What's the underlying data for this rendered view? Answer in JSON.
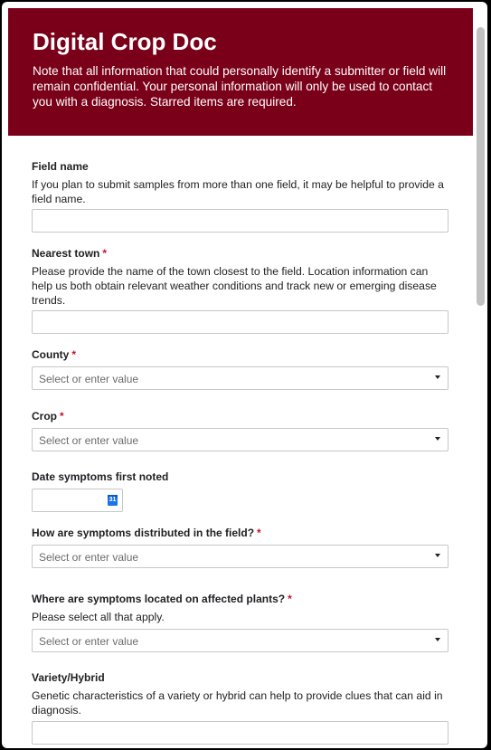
{
  "header": {
    "title": "Digital Crop Doc",
    "note": "Note that all information that could personally identify a submitter or field will remain confidential. Your personal information will only be used to contact you with a diagnosis. Starred items are required."
  },
  "colors": {
    "header_bg": "#7a0019",
    "required": "#c8102e",
    "calendar_icon": "#1a73e8"
  },
  "required_marker": "*",
  "fields": {
    "field_name": {
      "label": "Field name",
      "help": "If you plan to submit samples from more than one field, it may be helpful to provide a field name.",
      "value": ""
    },
    "nearest_town": {
      "label": "Nearest town",
      "help": "Please provide the name of the town closest to the field. Location information can help us both obtain relevant weather conditions and track new or emerging disease trends.",
      "value": ""
    },
    "county": {
      "label": "County",
      "placeholder": "Select or enter value"
    },
    "crop": {
      "label": "Crop",
      "placeholder": "Select or enter value"
    },
    "date_symptoms": {
      "label": "Date symptoms first noted",
      "icon": "calendar-icon",
      "icon_text": "31"
    },
    "distribution": {
      "label": "How are symptoms distributed in the field?",
      "placeholder": "Select or enter value"
    },
    "location": {
      "label": "Where are symptoms located on affected plants?",
      "help": "Please select all that apply.",
      "placeholder": "Select or enter value"
    },
    "variety": {
      "label": "Variety/Hybrid",
      "help": "Genetic characteristics of a variety or hybrid can help to provide clues that can aid in diagnosis."
    }
  }
}
